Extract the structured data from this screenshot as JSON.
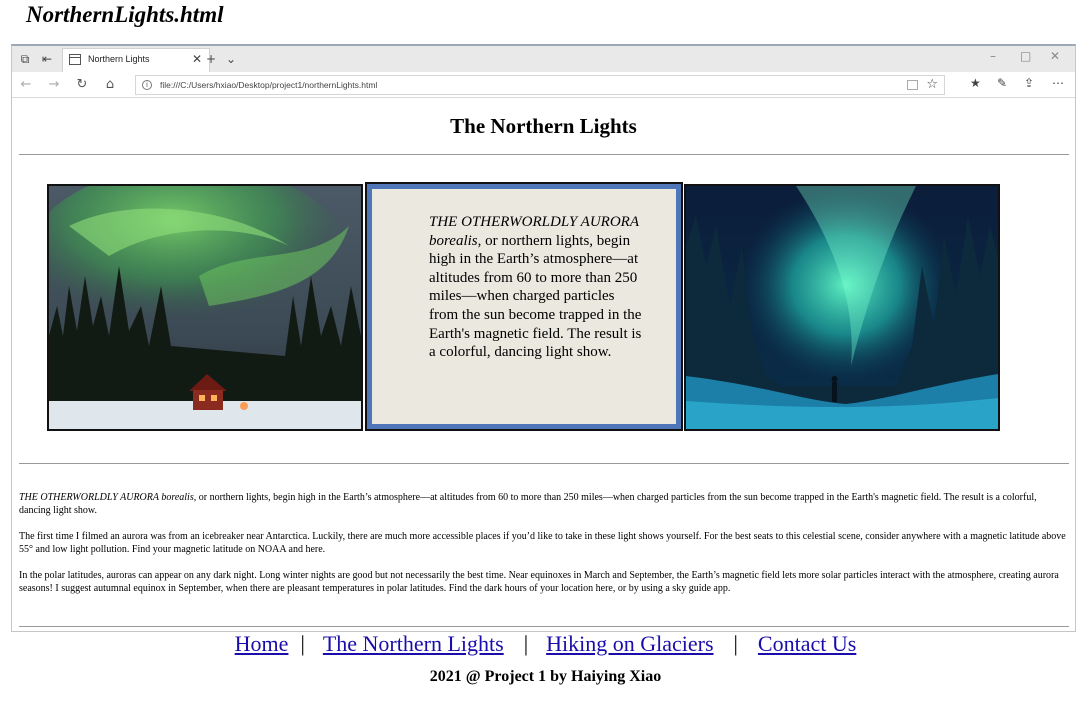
{
  "doc_title": "NorthernLights.html",
  "browser": {
    "tab_title": "Northern Lights",
    "url": "file:///C:/Users/hxiao/Desktop/project1/northernLights.html"
  },
  "page": {
    "heading": "The Northern Lights",
    "center_box": {
      "lead_italic": "THE OTHERWORLDLY AURORA borealis",
      "text": ", or northern lights, begin high in the Earth’s atmosphere—at altitudes from 60 to more than 250 miles—when charged particles from the sun become trapped in the Earth's magnetic field. The result is a colorful, dancing light show."
    },
    "paragraphs": [
      {
        "lead_italic": "THE OTHERWORLDLY AURORA borealis",
        "text": ", or northern lights, begin high in the Earth’s atmosphere—at altitudes from 60 to more than 250 miles—when charged particles from the sun become trapped in the Earth's magnetic field. The result is a colorful, dancing light show."
      },
      {
        "lead_italic": "",
        "text": "The first time I filmed an aurora was from an icebreaker near Antarctica. Luckily, there are much more accessible places if you’d like to take in these light shows yourself. For the best seats to this celestial scene, consider anywhere with a magnetic latitude above 55° and low light pollution. Find your magnetic latitude on NOAA and here."
      },
      {
        "lead_italic": "",
        "text": "In the polar latitudes, auroras can appear on any dark night. Long winter nights are good but not necessarily the best time. Near equinoxes in March and September, the Earth’s magnetic field lets more solar particles interact with the atmosphere, creating aurora seasons! I suggest autumnal equinox in September, when there are pleasant temperatures in polar latitudes. Find the dark hours of your location here, or by using a sky guide app."
      }
    ]
  },
  "footer": {
    "links": [
      "Home",
      "The Northern Lights",
      "Hiking on Glaciers",
      "Contact Us"
    ],
    "separator": "|",
    "credit": "2021 @ Project 1 by Haiying Xiao"
  },
  "icons": {
    "tab_actions": "tab-actions-icon",
    "set_aside": "set-aside-tabs-icon",
    "page_icon": "page-icon",
    "close_tab": "close-icon",
    "new_tab": "plus-icon",
    "tab_list": "chevron-down-icon",
    "back": "back-arrow-icon",
    "forward": "forward-arrow-icon",
    "refresh": "refresh-icon",
    "home": "home-icon",
    "info": "info-icon",
    "reading_view": "reading-view-icon",
    "favorite": "star-icon",
    "favorites_hub": "favorites-hub-icon",
    "notes": "pen-icon",
    "share": "share-icon",
    "more": "more-icon"
  },
  "colors": {
    "box_border": "#4f76b8",
    "box_background": "#ebe8df",
    "link": "#1a0dab"
  }
}
